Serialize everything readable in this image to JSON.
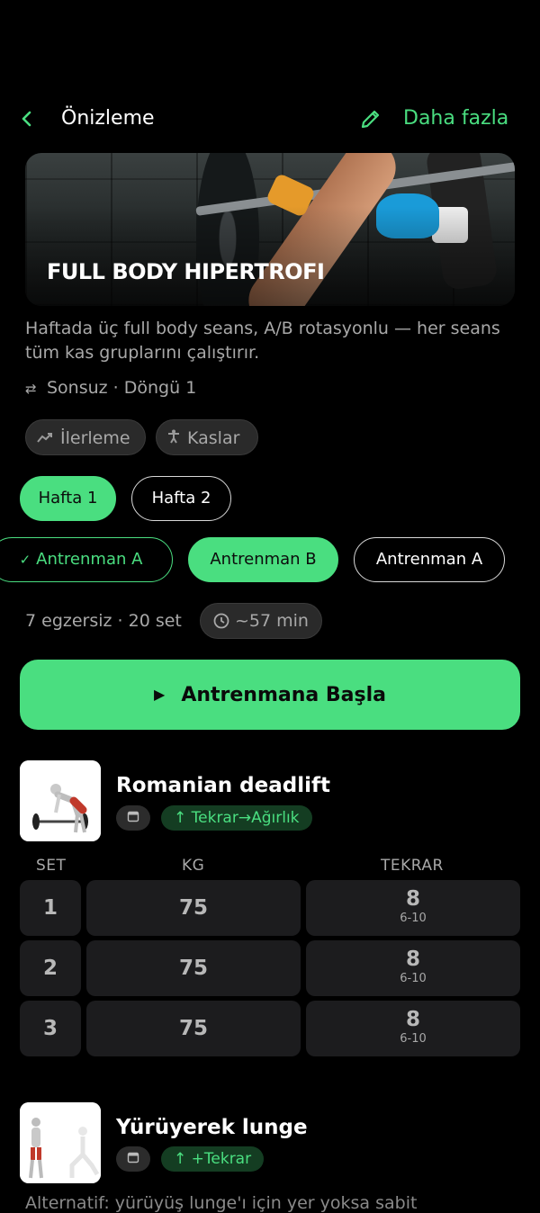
{
  "header": {
    "back_icon": "chevron-left-icon",
    "title": "Önizleme",
    "edit_icon": "pencil-icon",
    "more_label": "Daha fazla",
    "accent": "#4ade80"
  },
  "program": {
    "title": "FULL BODY HIPERTROFI",
    "description": "Haftada üç full body seans, A/B rotasyonlu — her seans tüm kas gruplarını çalıştırır.",
    "cycle": "Sonsuz · Döngü 1",
    "chips": [
      {
        "icon": "trend-up-icon",
        "label": "İlerleme"
      },
      {
        "icon": "body-icon",
        "label": "Kaslar"
      }
    ]
  },
  "weeks": [
    {
      "label": "Hafta 1",
      "selected": true
    },
    {
      "label": "Hafta 2",
      "selected": false
    }
  ],
  "workouts": [
    {
      "label": "Antrenman A",
      "state": "done"
    },
    {
      "label": "Antrenman B",
      "state": "selected"
    },
    {
      "label": "Antrenman A",
      "state": "default"
    }
  ],
  "summary": {
    "stats": "7 egzersiz · 20 set",
    "time": "~57 min"
  },
  "start_label": "Antrenmana Başla",
  "columns": {
    "set": "SET",
    "kg": "KG",
    "reps": "TEKRAR"
  },
  "exercises": [
    {
      "name": "Romanian deadlift",
      "progression": "↑ Tekrar→Ağırlık",
      "sets": [
        {
          "set": "1",
          "kg": "75",
          "reps": "8",
          "range": "6-10"
        },
        {
          "set": "2",
          "kg": "75",
          "reps": "8",
          "range": "6-10"
        },
        {
          "set": "3",
          "kg": "75",
          "reps": "8",
          "range": "6-10"
        }
      ]
    },
    {
      "name": "Yürüyerek lunge",
      "progression": "↑ +Tekrar",
      "note": "Alternatif: yürüyüş lunge'ı için yer yoksa sabit"
    }
  ]
}
